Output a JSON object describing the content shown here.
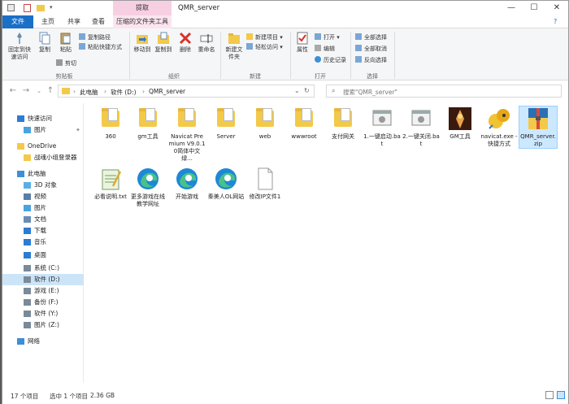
{
  "window": {
    "title": "QMR_server",
    "context_tab": "提取",
    "controls": [
      "—",
      "☐",
      "✕"
    ]
  },
  "tabs": {
    "file": "文件",
    "home": "主页",
    "share": "共享",
    "view": "查看",
    "manage": "压缩的文件夹工具"
  },
  "ribbon": {
    "pin_quick_access": "固定到快速访问",
    "copy": "复制",
    "paste": "粘贴",
    "copy_path": "复制路径",
    "paste_shortcut": "粘贴快捷方式",
    "cut": "剪切",
    "clipboard_group": "剪贴板",
    "move_to": "移动到",
    "copy_to": "复制到",
    "delete": "删除",
    "rename": "重命名",
    "organize_group": "组织",
    "new_folder": "新建文件夹",
    "new_item": "新建项目 ▾",
    "easy_access": "轻松访问 ▾",
    "new_group": "新建",
    "properties": "属性",
    "open": "打开 ▾",
    "edit": "编辑",
    "history": "历史记录",
    "open_group": "打开",
    "select_all": "全部选择",
    "select_none": "全部取消",
    "invert_selection": "反向选择",
    "select_group": "选择"
  },
  "address": {
    "crumbs": [
      "此电脑",
      "软件 (D:)",
      "QMR_server"
    ],
    "separator": "›",
    "search_placeholder": "搜索\"QMR_server\""
  },
  "sidebar": {
    "items": [
      {
        "label": "快速访问",
        "icon": "star-icon",
        "color": "#2b7cd3"
      },
      {
        "label": "图片",
        "icon": "pictures-icon",
        "color": "#4aa3df"
      },
      {
        "label": "OneDrive",
        "icon": "onedrive-icon",
        "color": "#f3c94a"
      },
      {
        "label": "战魂小组登录器",
        "icon": "folder-icon",
        "color": "#f3c94a"
      },
      {
        "label": "此电脑",
        "icon": "computer-icon",
        "color": "#3d8fd8"
      },
      {
        "label": "3D 对象",
        "icon": "3d-objects-icon",
        "color": "#5ab0e6"
      },
      {
        "label": "视频",
        "icon": "video-icon",
        "color": "#5a7fa6"
      },
      {
        "label": "图片",
        "icon": "pictures-icon",
        "color": "#4aa3df"
      },
      {
        "label": "文档",
        "icon": "documents-icon",
        "color": "#6a8db2"
      },
      {
        "label": "下载",
        "icon": "download-icon",
        "color": "#2b7cd3"
      },
      {
        "label": "音乐",
        "icon": "music-icon",
        "color": "#2b7cd3"
      },
      {
        "label": "桌面",
        "icon": "desktop-icon",
        "color": "#2b7cd3"
      },
      {
        "label": "系统 (C:)",
        "icon": "drive-icon",
        "color": "#7a8a99"
      },
      {
        "label": "软件 (D:)",
        "icon": "drive-icon",
        "color": "#7a8a99",
        "selected": true
      },
      {
        "label": "游戏 (E:)",
        "icon": "drive-icon",
        "color": "#7a8a99"
      },
      {
        "label": "备份 (F:)",
        "icon": "drive-icon",
        "color": "#7a8a99"
      },
      {
        "label": "软件 (Y:)",
        "icon": "drive-icon",
        "color": "#7a8a99"
      },
      {
        "label": "图片 (Z:)",
        "icon": "drive-icon",
        "color": "#7a8a99"
      },
      {
        "label": "网络",
        "icon": "network-icon",
        "color": "#3d8fd8"
      }
    ]
  },
  "files": [
    {
      "name": "360",
      "icon": "folder-icon"
    },
    {
      "name": "gm工具",
      "icon": "folder-icon"
    },
    {
      "name": "Navicat Premium V9.0.10简体中文绿...",
      "icon": "folder-icon"
    },
    {
      "name": "Server",
      "icon": "folder-icon"
    },
    {
      "name": "web",
      "icon": "folder-icon"
    },
    {
      "name": "wwwroot",
      "icon": "folder-icon"
    },
    {
      "name": "支付网关",
      "icon": "folder-icon"
    },
    {
      "name": "1.一键启动.bat",
      "icon": "bat-icon"
    },
    {
      "name": "2.一键关闭.bat",
      "icon": "bat-icon"
    },
    {
      "name": "GM工具",
      "icon": "game-icon"
    },
    {
      "name": "navicat.exe - 快捷方式",
      "icon": "navicat-icon"
    },
    {
      "name": "QMR_server.zip",
      "icon": "zip-icon",
      "selected": true
    },
    {
      "name": "必看说明.txt",
      "icon": "notepad-icon"
    },
    {
      "name": "更多游戏在线教学网址",
      "icon": "edge-icon"
    },
    {
      "name": "开始游戏",
      "icon": "edge-icon"
    },
    {
      "name": "秦美人OL网站",
      "icon": "edge-icon"
    },
    {
      "name": "修改IP文件1",
      "icon": "blank-file-icon"
    }
  ],
  "status": {
    "count": "17 个项目",
    "selected": "选中 1 个项目",
    "size": "2.36 GB"
  }
}
